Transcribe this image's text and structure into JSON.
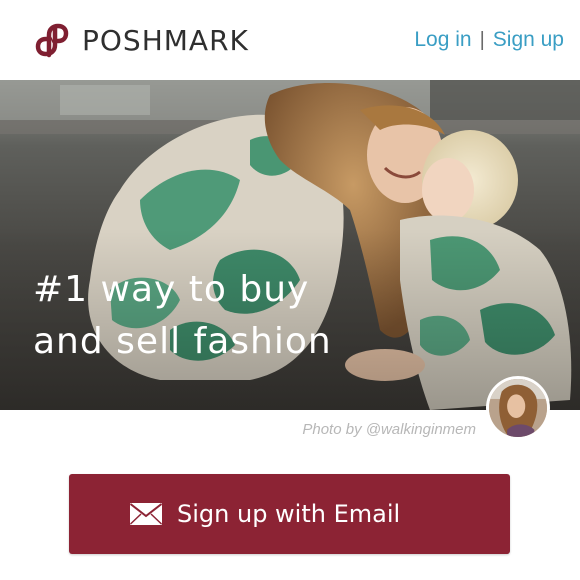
{
  "header": {
    "brand_name": "POSHMARK",
    "brand_icon": "poshmark-logo-icon",
    "login_label": "Log in",
    "separator": "|",
    "signup_label": "Sign up"
  },
  "hero": {
    "title_line1": "#1 way to buy",
    "title_line2": "and sell fashion",
    "photo_credit": "Photo by @walkinginmem",
    "avatar_icon": "photographer-avatar"
  },
  "cta": {
    "email_signup_label": "Sign up with Email",
    "icon": "mail-icon"
  },
  "colors": {
    "brand": "#8c2334",
    "link": "#3a9ec4",
    "text_dark": "#2f2f2f",
    "credit_text": "#b7b7b7"
  }
}
